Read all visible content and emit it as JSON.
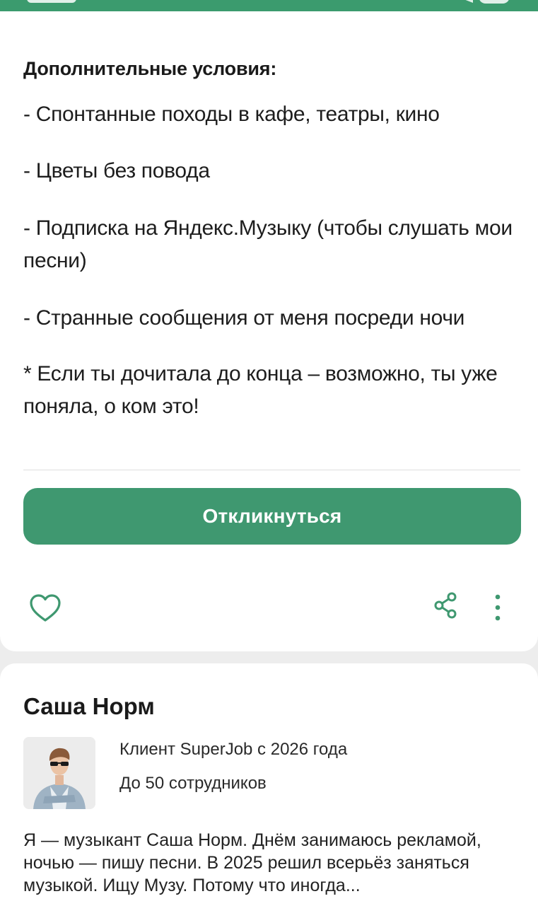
{
  "colors": {
    "accent": "#3f9870",
    "status_bar": "#3b9b6e"
  },
  "conditions": {
    "title": "Дополнительные условия:",
    "items": [
      "- Спонтанные походы в кафе, театры, кино",
      "- Цветы без повода",
      "- Подписка на Яндекс.Музыку (чтобы слушать мои песни)",
      "- Странные сообщения от меня посреди ночи",
      "* Если ты дочитала до конца – возможно, ты уже поняла, о ком это!"
    ]
  },
  "actions": {
    "respond_label": "Откликнуться",
    "favorite_icon": "heart-icon",
    "share_icon": "share-icon",
    "more_icon": "more-vertical-icon"
  },
  "company": {
    "name": "Саша Норм",
    "client_since": "Клиент SuperJob с 2026 года",
    "size": "До 50 сотрудников",
    "description": "Я — музыкант Саша Норм. Днём занимаюсь рекламой, ночью — пишу песни. В 2025 решил всерьёз заняться музыкой. Ищу Музу. Потому что иногда..."
  }
}
